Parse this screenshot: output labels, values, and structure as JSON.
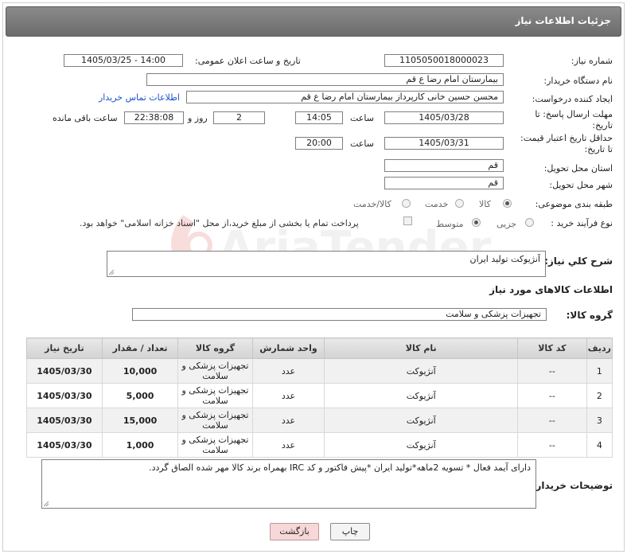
{
  "header": {
    "title": "جزئیات اطلاعات نیاز"
  },
  "labels": {
    "need_number": "شماره نیاز:",
    "announce_date": "تاریخ و ساعت اعلان عمومی:",
    "buyer_org": "نام دستگاه خریدار:",
    "requester": "ایجاد کننده درخواست:",
    "reply_deadline": "مهلت ارسال پاسخ: تا تاریخ:",
    "time": "ساعت",
    "day_and": "روز و",
    "remaining": "ساعت باقی مانده",
    "price_validity": "حداقل تاریخ اعتبار قیمت: تا تاریخ:",
    "province": "استان محل تحویل:",
    "city": "شهر محل تحویل:",
    "category": "طبقه بندی موضوعی:",
    "process_type": "نوع فرآیند خرید :",
    "general_desc": "شرح کلي نياز:",
    "goods_info": "اطلاعات کالاهای مورد نیاز",
    "goods_group": "گروه کالا:",
    "buyer_notes": "توضیحات خریدار:"
  },
  "fields": {
    "need_number": "1105050018000023",
    "announce_date": "1405/03/25 - 14:00",
    "buyer_org": "بیمارستان امام رضا ع  قم",
    "requester": "محسن حسین خانی کارپرداز بیمارستان امام رضا ع  قم",
    "contact_link": "اطلاعات تماس خریدار",
    "reply_date": "1405/03/28",
    "reply_time": "14:05",
    "reply_days": "2",
    "reply_remaining": "22:38:08",
    "validity_date": "1405/03/31",
    "validity_time": "20:00",
    "province": "قم",
    "city": "قم",
    "general_desc": "آنژیوکت تولید ایران",
    "goods_group": "تجهیزات پزشکی و سلامت",
    "buyer_notes": "دارای آیمد فعال * تسویه 2ماهه*تولید ایران *پیش فاکتور و کد IRC بهمراه برند کالا مهر شده الصاق گردد."
  },
  "category_options": [
    {
      "label": "کالا",
      "selected": true
    },
    {
      "label": "خدمت",
      "selected": false
    },
    {
      "label": "کالا/خدمت",
      "selected": false
    }
  ],
  "process_options": [
    {
      "label": "جزیی",
      "selected": false
    },
    {
      "label": "متوسط",
      "selected": true
    }
  ],
  "payment_note": "پرداخت تمام یا بخشی از مبلغ خرید،از محل \"اسناد خزانه اسلامی\" خواهد بود.",
  "table": {
    "headers": [
      "ردیف",
      "کد کالا",
      "نام کالا",
      "واحد شمارش",
      "گروه کالا",
      "تعداد / مقدار",
      "تاریخ نیاز"
    ],
    "rows": [
      [
        "1",
        "--",
        "آنژیوکت",
        "عدد",
        "تجهیزات پزشکی و سلامت",
        "10,000",
        "1405/03/30"
      ],
      [
        "2",
        "--",
        "آنژیوکت",
        "عدد",
        "تجهیزات پزشکی و سلامت",
        "5,000",
        "1405/03/30"
      ],
      [
        "3",
        "--",
        "آنژیوکت",
        "عدد",
        "تجهیزات پزشکی و سلامت",
        "15,000",
        "1405/03/30"
      ],
      [
        "4",
        "--",
        "آنژیوکت",
        "عدد",
        "تجهیزات پزشکی و سلامت",
        "1,000",
        "1405/03/30"
      ]
    ]
  },
  "buttons": {
    "print": "چاپ",
    "back": "بازگشت"
  },
  "watermark": {
    "text": "AriaTender.net"
  },
  "colors": {
    "link": "#1a52c9",
    "back_button": "#f7d7d7",
    "header_bg": "#7a7a7a"
  }
}
